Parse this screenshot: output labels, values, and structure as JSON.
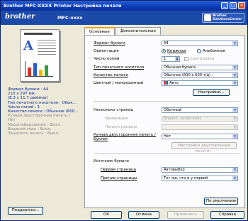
{
  "window": {
    "title": "Brother MFC-XXXX Printer Настройка печати",
    "minimize": "_",
    "maximize": "□",
    "close": "×"
  },
  "banner": {
    "brand": "brother",
    "model": "MFC-xxxx",
    "solutions_line1": "Brother",
    "solutions_line2": "SolutionsCenter"
  },
  "tabs": [
    "Основные",
    "Дополнительные"
  ],
  "summary": {
    "lines": [
      {
        "text": "Формат бумаги : A4",
        "style": "blue"
      },
      {
        "text": "210 x 297 мм",
        "style": "blue"
      },
      {
        "text": "(8.3 x 11.7 дюймов)",
        "style": "blue"
      },
      {
        "text": "Тип печатного носителя : Обык...",
        "style": "blue"
      },
      {
        "text": "Число копий : 1",
        "style": "blue"
      },
      {
        "text": "Качество печати : Обычное (600...",
        "style": "blue"
      },
      {
        "text": "Ручная двусторонняя печать /",
        "style": "gray"
      },
      {
        "text": "Нет",
        "style": "gray"
      },
      {
        "text": "Масштабирование : Выкл.",
        "style": "gray"
      },
      {
        "text": "Водяной знак : Выкл.",
        "style": "gray"
      },
      {
        "text": "Защитить печать : Выкл.",
        "style": "gray"
      }
    ],
    "support_button": "Поддержка..."
  },
  "form": {
    "paper_size": {
      "label": "Формат бумаги",
      "value": "A4"
    },
    "orientation": {
      "label": "Ориентация",
      "portrait": "Книжная",
      "landscape": "Альбомная",
      "selected": "portrait"
    },
    "copies": {
      "label": "Число копий",
      "value": "1",
      "collate_label": "Сортировка"
    },
    "media_type": {
      "label": "Тип печатного носителя",
      "value": "Обычная бумага"
    },
    "print_quality": {
      "label": "Качество печати",
      "value": "Обычное (600 x 600 т/д)"
    },
    "color_mono": {
      "label": "Цветной / монохромный",
      "value": "Авто"
    },
    "settings_button": "Настройки...",
    "multiple_page": {
      "label": "Несколько страниц",
      "value": "Обычный"
    },
    "page_order": {
      "label": "Нумерация",
      "value": "Вправо, затем вниз"
    },
    "border_line": {
      "label": "Линия границы",
      "value": ""
    },
    "duplex": {
      "label": "Ручная двусторонняя печать / Буклет",
      "value": "Нет"
    },
    "duplex_settings_button": "Настройки двусторонней печати...",
    "paper_source": {
      "label": "Источник бумаги"
    },
    "first_page": {
      "label": "Первая страница",
      "value": "Автовыбор"
    },
    "other_pages": {
      "label": "Прочие страницы",
      "value": "Тот же, что и у первой"
    },
    "default_button": "По умолчанию"
  },
  "footer": {
    "ok": "ОК",
    "cancel": "Отмена",
    "apply": "Применить",
    "help": "Справка"
  },
  "colors": {
    "title_bar": "#0a3cb8",
    "banner": "#1c4aa8",
    "summary_text": "#0a2a9a"
  }
}
